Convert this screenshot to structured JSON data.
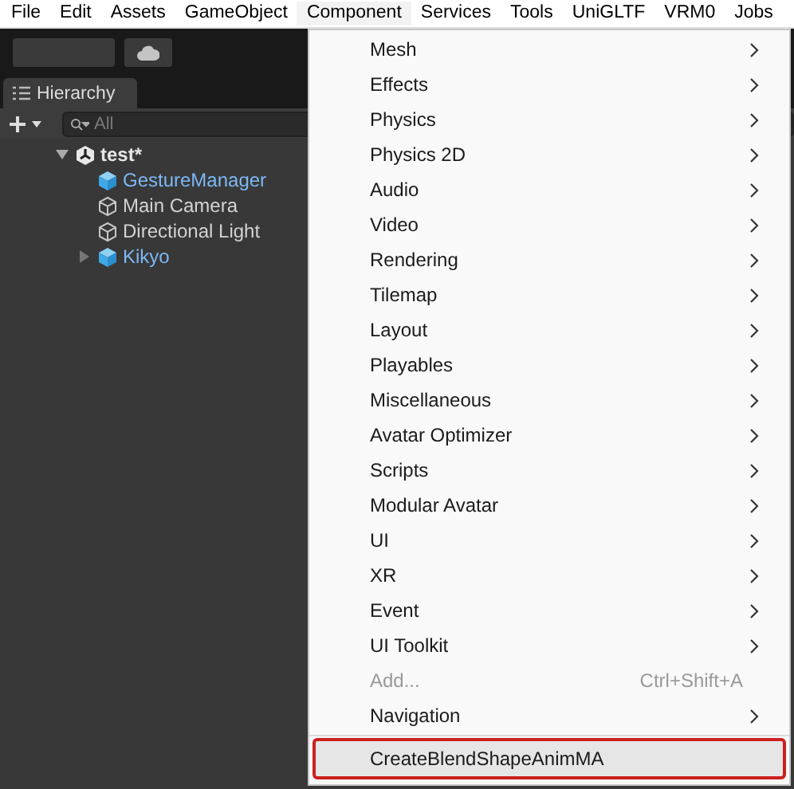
{
  "menu_bar": [
    {
      "label": "File",
      "selected": false
    },
    {
      "label": "Edit",
      "selected": false
    },
    {
      "label": "Assets",
      "selected": false
    },
    {
      "label": "GameObject",
      "selected": false
    },
    {
      "label": "Component",
      "selected": true
    },
    {
      "label": "Services",
      "selected": false
    },
    {
      "label": "Tools",
      "selected": false
    },
    {
      "label": "UniGLTF",
      "selected": false
    },
    {
      "label": "VRM0",
      "selected": false
    },
    {
      "label": "Jobs",
      "selected": false
    }
  ],
  "hierarchy": {
    "tab": "Hierarchy",
    "search": {
      "placeholder": "All"
    },
    "tree": [
      {
        "label": "test*",
        "kind": "scene",
        "expanded": true,
        "children": [
          {
            "label": "GestureManager",
            "kind": "prefab"
          },
          {
            "label": "Main Camera",
            "kind": "object"
          },
          {
            "label": "Directional Light",
            "kind": "object"
          },
          {
            "label": "Kikyo",
            "kind": "prefab",
            "expanded": false
          }
        ]
      }
    ]
  },
  "dropdown": [
    {
      "label": "Mesh",
      "submenu": true,
      "disabled": false,
      "selected": false
    },
    {
      "label": "Effects",
      "submenu": true,
      "disabled": false,
      "selected": false
    },
    {
      "label": "Physics",
      "submenu": true,
      "disabled": false,
      "selected": false
    },
    {
      "label": "Physics 2D",
      "submenu": true,
      "disabled": false,
      "selected": false
    },
    {
      "label": "Audio",
      "submenu": true,
      "disabled": false,
      "selected": false
    },
    {
      "label": "Video",
      "submenu": true,
      "disabled": false,
      "selected": false
    },
    {
      "label": "Rendering",
      "submenu": true,
      "disabled": false,
      "selected": false
    },
    {
      "label": "Tilemap",
      "submenu": true,
      "disabled": false,
      "selected": false
    },
    {
      "label": "Layout",
      "submenu": true,
      "disabled": false,
      "selected": false
    },
    {
      "label": "Playables",
      "submenu": true,
      "disabled": false,
      "selected": false
    },
    {
      "label": "Miscellaneous",
      "submenu": true,
      "disabled": false,
      "selected": false
    },
    {
      "label": "Avatar Optimizer",
      "submenu": true,
      "disabled": false,
      "selected": false
    },
    {
      "label": "Scripts",
      "submenu": true,
      "disabled": false,
      "selected": false
    },
    {
      "label": "Modular Avatar",
      "submenu": true,
      "disabled": false,
      "selected": false
    },
    {
      "label": "UI",
      "submenu": true,
      "disabled": false,
      "selected": false
    },
    {
      "label": "XR",
      "submenu": true,
      "disabled": false,
      "selected": false
    },
    {
      "label": "Event",
      "submenu": true,
      "disabled": false,
      "selected": false
    },
    {
      "label": "UI Toolkit",
      "submenu": true,
      "disabled": false,
      "selected": false
    },
    {
      "label": "Add...",
      "submenu": false,
      "shortcut": "Ctrl+Shift+A",
      "disabled": true,
      "selected": false
    },
    {
      "label": "Navigation",
      "submenu": true,
      "disabled": false,
      "selected": false
    },
    {
      "label": "CreateBlendShapeAnimMA",
      "submenu": false,
      "disabled": false,
      "selected": true,
      "separator_before": true
    }
  ]
}
